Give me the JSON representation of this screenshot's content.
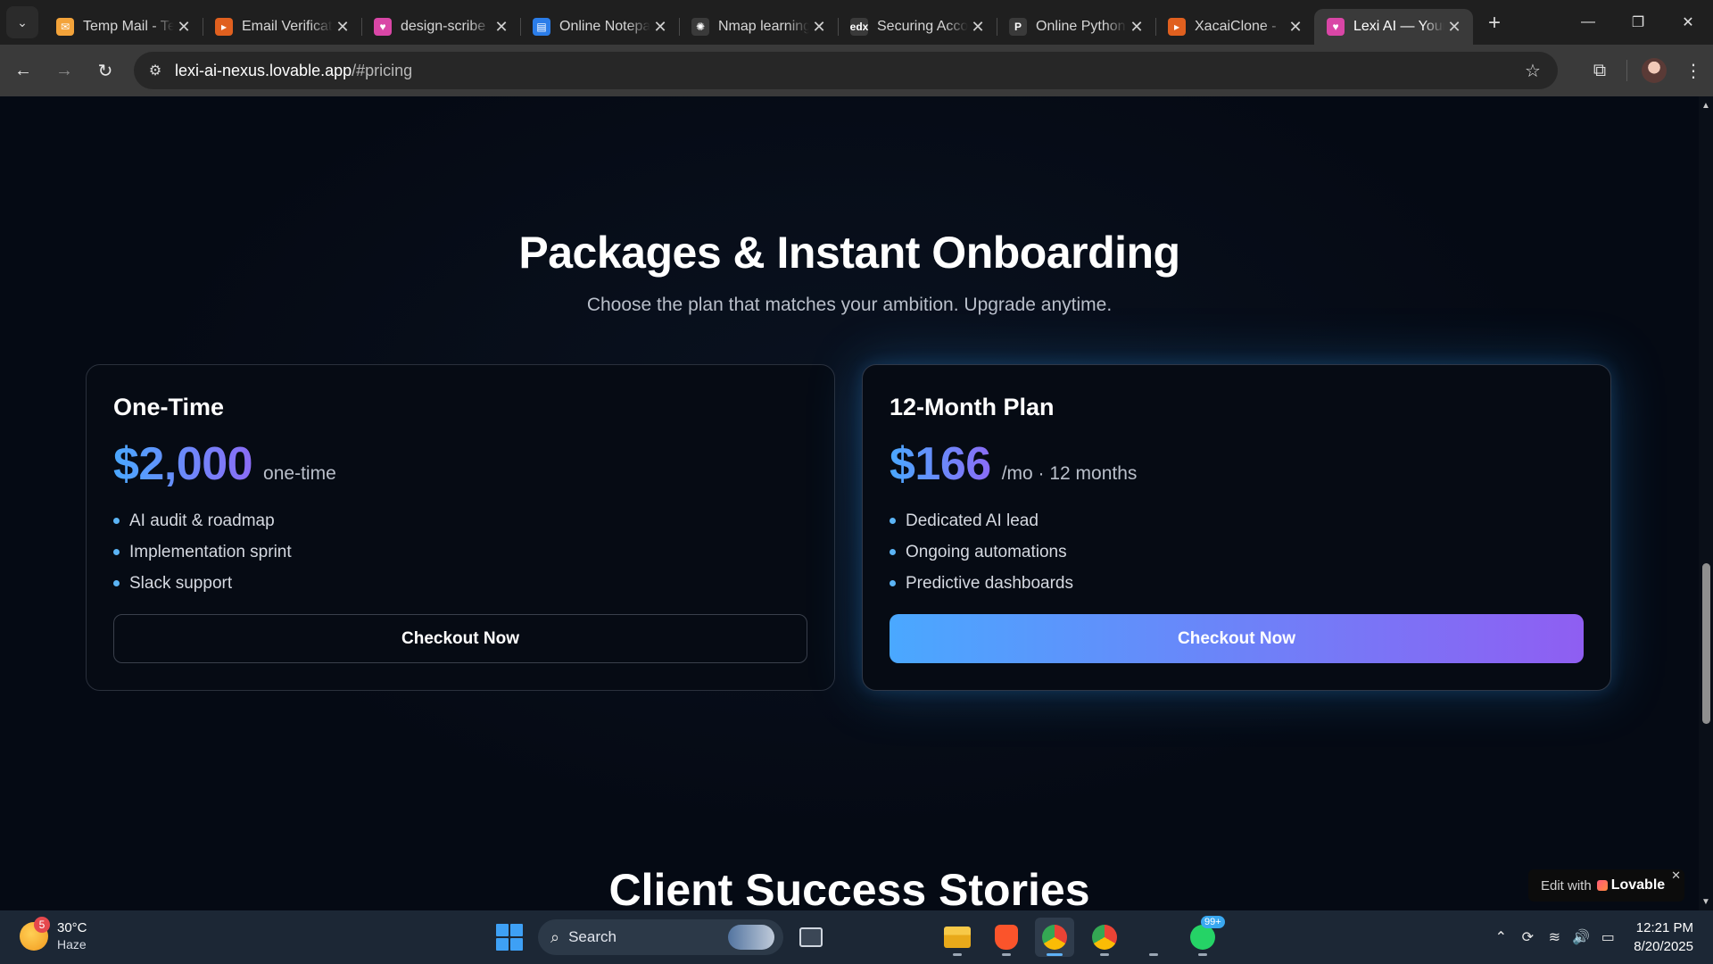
{
  "browser": {
    "tabs": [
      {
        "title": "Temp Mail - Temporary Email",
        "favicon_color": "#f3a33a",
        "favicon_glyph": "✉",
        "icon": "mail-icon"
      },
      {
        "title": "Email Verification",
        "favicon_color": "#e0601f",
        "favicon_glyph": "▸",
        "icon": "arrow-logo-icon"
      },
      {
        "title": "design-scribe",
        "favicon_color": "#d946a6",
        "favicon_glyph": "♥",
        "icon": "lovable-icon"
      },
      {
        "title": "Online Notepad",
        "favicon_color": "#2b7de9",
        "favicon_glyph": "▤",
        "icon": "notepad-icon"
      },
      {
        "title": "Nmap learning",
        "favicon_color": "#3a3a3a",
        "favicon_glyph": "✺",
        "icon": "chatgpt-icon"
      },
      {
        "title": "Securing Accounts",
        "favicon_color": "#3a3a3a",
        "favicon_glyph": "edx",
        "icon": "edx-icon"
      },
      {
        "title": "Online Python",
        "favicon_color": "#3a3a3a",
        "favicon_glyph": "P",
        "icon": "python-icon"
      },
      {
        "title": "XacaiClone - ",
        "favicon_color": "#e0601f",
        "favicon_glyph": "▸",
        "icon": "arrow-logo-icon"
      },
      {
        "title": "Lexi AI — Your",
        "favicon_color": "#d946a6",
        "favicon_glyph": "♥",
        "icon": "lovable-icon",
        "active": true
      }
    ],
    "url_host": "lexi-ai-nexus.lovable.app",
    "url_path": "/#pricing"
  },
  "page": {
    "title": "Packages & Instant Onboarding",
    "subtitle": "Choose the plan that matches your ambition. Upgrade anytime.",
    "plans": [
      {
        "name": "One-Time",
        "price": "$2,000",
        "price_note": "one-time",
        "features": [
          "AI audit & roadmap",
          "Implementation sprint",
          "Slack support"
        ],
        "cta": "Checkout Now"
      },
      {
        "name": "12-Month Plan",
        "price": "$166",
        "price_note": "/mo · 12 months",
        "features": [
          "Dedicated AI lead",
          "Ongoing automations",
          "Predictive dashboards"
        ],
        "cta": "Checkout Now",
        "highlighted": true
      }
    ],
    "next_section_title": "Client Success Stories",
    "badge": {
      "prefix": "Edit with",
      "brand": "Lovable"
    }
  },
  "colors": {
    "background": "#050a14",
    "accent_blue": "#4aa8ff",
    "accent_purple": "#8f5ef2",
    "bullet": "#5bb4f5"
  },
  "taskbar": {
    "weather_temp": "30°C",
    "weather_cond": "Haze",
    "weather_badge": "5",
    "search_label": "Search",
    "whatsapp_badge": "99+",
    "time": "12:21 PM",
    "date": "8/20/2025"
  }
}
